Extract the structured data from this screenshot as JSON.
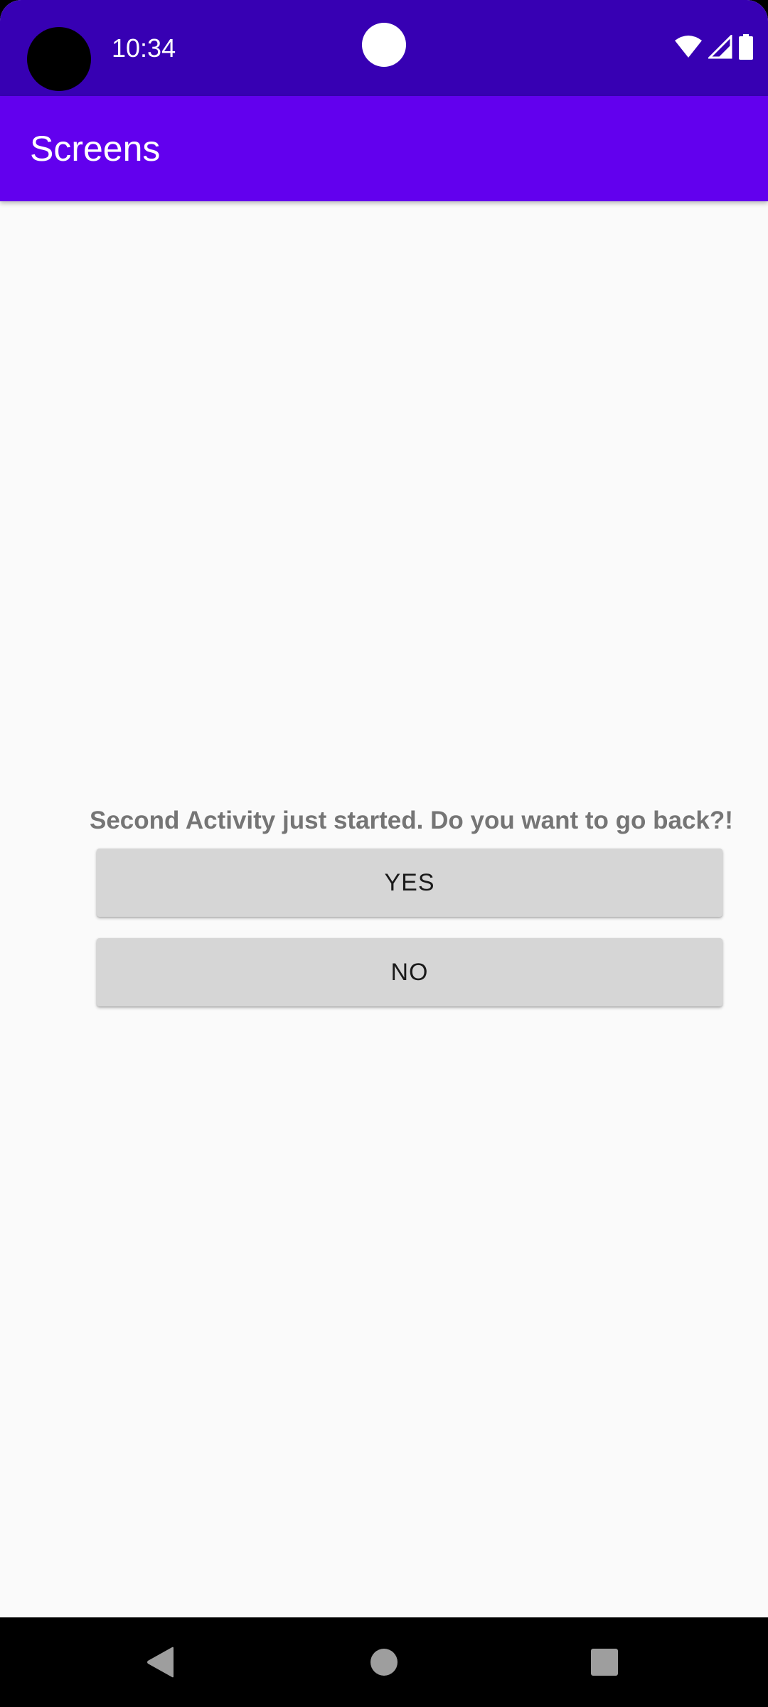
{
  "status_bar": {
    "time": "10:34",
    "icons": [
      "wifi-icon",
      "cellular-signal-icon",
      "battery-icon"
    ],
    "background": "#3700b3"
  },
  "app_bar": {
    "title": "Screens",
    "background": "#6200ee"
  },
  "content": {
    "prompt": "Second Activity just started. Do you want to go back?!",
    "yes_label": "YES",
    "no_label": "NO"
  },
  "navigation_bar": {
    "buttons": [
      "back-icon",
      "home-icon",
      "recents-icon"
    ]
  }
}
